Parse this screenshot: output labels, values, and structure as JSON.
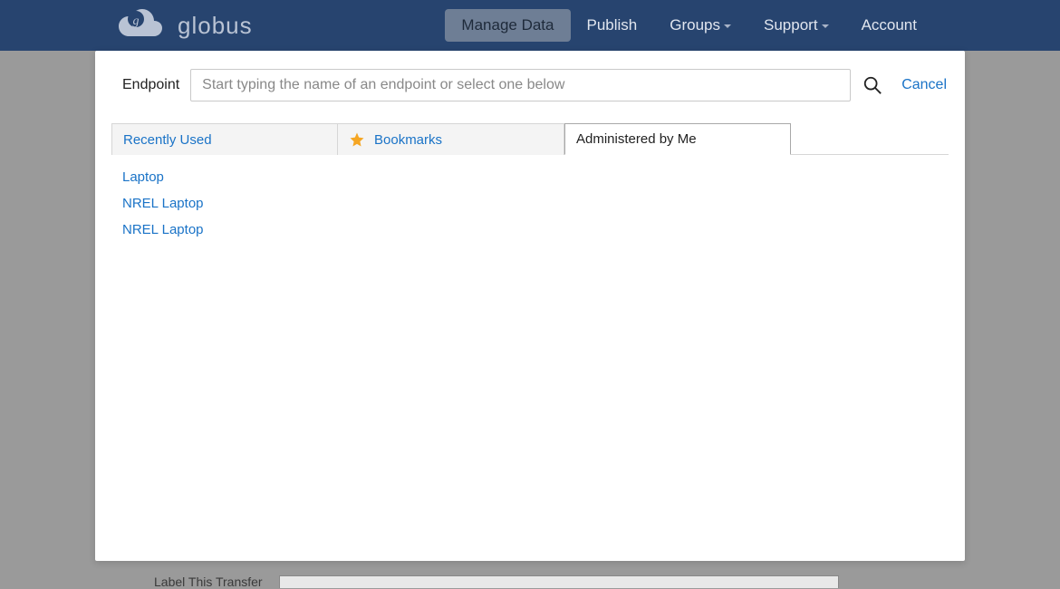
{
  "header": {
    "brand": "globus",
    "nav": [
      {
        "label": "Manage Data",
        "active": true,
        "has_caret": false
      },
      {
        "label": "Publish",
        "active": false,
        "has_caret": false
      },
      {
        "label": "Groups",
        "active": false,
        "has_caret": true
      },
      {
        "label": "Support",
        "active": false,
        "has_caret": true
      },
      {
        "label": "Account",
        "active": false,
        "has_caret": false
      }
    ]
  },
  "modal": {
    "endpoint_label": "Endpoint",
    "search_placeholder": "Start typing the name of an endpoint or select one below",
    "cancel_label": "Cancel",
    "tabs": [
      {
        "label": "Recently Used",
        "icon": null
      },
      {
        "label": "Bookmarks",
        "icon": "star"
      },
      {
        "label": "Administered by Me",
        "icon": null
      }
    ],
    "active_tab": 2,
    "endpoints": [
      "Laptop",
      "NREL Laptop",
      "NREL Laptop"
    ]
  },
  "background": {
    "label_text": "Label This Transfer"
  }
}
